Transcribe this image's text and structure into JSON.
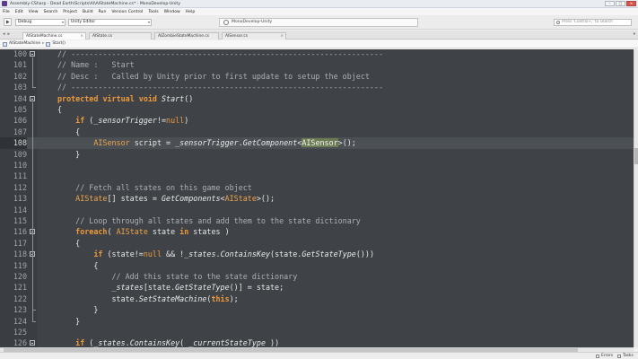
{
  "window": {
    "title": "Assembly-CSharp - Dead Earth\\Scripts\\AI\\AIStateMachine.cs* - MonoDevelop-Unity",
    "controls": [
      "–",
      "□",
      "×"
    ]
  },
  "menu": [
    "File",
    "Edit",
    "View",
    "Search",
    "Project",
    "Build",
    "Run",
    "Version Control",
    "Tools",
    "Window",
    "Help"
  ],
  "toolbar": {
    "configuration": "Debug",
    "target": "Unity Editor",
    "status": "MonoDevelop-Unity",
    "search_placeholder": "Press 'Control+,' to search"
  },
  "tabs": [
    {
      "label": "AIStateMachine.cs",
      "active": true
    },
    {
      "label": "AIState.cs",
      "active": false
    },
    {
      "label": "AIZombieStateMachine.cs",
      "active": false
    },
    {
      "label": "AISensor.cs",
      "active": false
    }
  ],
  "breadcrumb": {
    "class_name": "AIStateMachine",
    "separator": "▸",
    "method": "Start()"
  },
  "editor": {
    "current_line": 108,
    "lines": [
      {
        "n": 100,
        "text": "// ---------------------------------------------------------------------"
      },
      {
        "n": 101,
        "text": "// Name :   Start"
      },
      {
        "n": 102,
        "text": "// Desc :   Called by Unity prior to first update to setup the object"
      },
      {
        "n": 103,
        "text": "// ---------------------------------------------------------------------"
      },
      {
        "n": 104,
        "text": "protected virtual void Start()"
      },
      {
        "n": 105,
        "text": "{"
      },
      {
        "n": 106,
        "text": "    if (_sensorTrigger!=null)"
      },
      {
        "n": 107,
        "text": "    {"
      },
      {
        "n": 108,
        "text": "        AISensor script = _sensorTrigger.GetComponent<AISensor>();"
      },
      {
        "n": 109,
        "text": "    }"
      },
      {
        "n": 110,
        "text": ""
      },
      {
        "n": 111,
        "text": ""
      },
      {
        "n": 112,
        "text": "    // Fetch all states on this game object"
      },
      {
        "n": 113,
        "text": "    AIState[] states = GetComponents<AIState>();"
      },
      {
        "n": 114,
        "text": ""
      },
      {
        "n": 115,
        "text": "    // Loop through all states and add them to the state dictionary"
      },
      {
        "n": 116,
        "text": "    foreach( AIState state in states )"
      },
      {
        "n": 117,
        "text": "    {"
      },
      {
        "n": 118,
        "text": "        if (state!=null && !_states.ContainsKey(state.GetStateType()))"
      },
      {
        "n": 119,
        "text": "        {"
      },
      {
        "n": 120,
        "text": "            // Add this state to the state dictionary"
      },
      {
        "n": 121,
        "text": "            _states[state.GetStateType()] = state;"
      },
      {
        "n": 122,
        "text": "            state.SetStateMachine(this);"
      },
      {
        "n": 123,
        "text": "        }"
      },
      {
        "n": 124,
        "text": "    }"
      },
      {
        "n": 125,
        "text": ""
      },
      {
        "n": 126,
        "text": "    if (_states.ContainsKey( _currentStateType ))"
      }
    ]
  },
  "statusbar": {
    "errors_label": "Errors",
    "tasks_label": "Tasks"
  },
  "colors": {
    "editor_bg": "#3f4347",
    "keyword": "#ee9a3b",
    "comment": "#aab0b5",
    "highlight": "#6b7c52"
  }
}
